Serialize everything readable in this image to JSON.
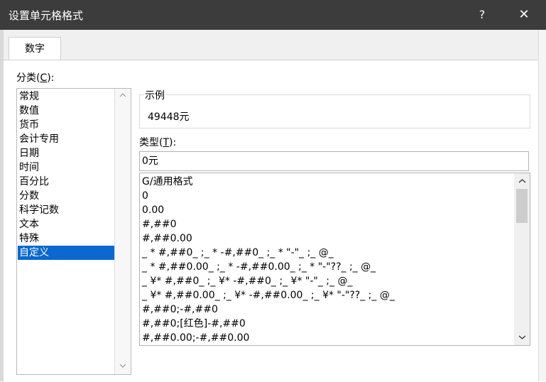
{
  "dialog": {
    "title": "设置单元格格式",
    "help_label": "?",
    "close_label": "✕"
  },
  "tabs": [
    {
      "label": "数字"
    }
  ],
  "category": {
    "label_prefix": "分类(",
    "label_key": "C",
    "label_suffix": "):",
    "items": [
      "常规",
      "数值",
      "货币",
      "会计专用",
      "日期",
      "时间",
      "百分比",
      "分数",
      "科学记数",
      "文本",
      "特殊",
      "自定义"
    ],
    "selected": "自定义"
  },
  "sample": {
    "label": "示例",
    "value": "49448元"
  },
  "type": {
    "label_prefix": "类型(",
    "label_key": "T",
    "label_suffix": "):",
    "value": "0元"
  },
  "formats": [
    "G/通用格式",
    "0",
    "0.00",
    "#,##0",
    "#,##0.00",
    "_ * #,##0_ ;_ * -#,##0_ ;_ * \"-\"_ ;_ @_",
    "_ * #,##0.00_ ;_ * -#,##0.00_ ;_ * \"-\"??_ ;_ @_",
    "_ ¥* #,##0_ ;_ ¥* -#,##0_ ;_ ¥* \"-\"_ ;_ @_",
    "_ ¥* #,##0.00_ ;_ ¥* -#,##0.00_ ;_ ¥* \"-\"??_ ;_ @_",
    "#,##0;-#,##0",
    "#,##0;[红色]-#,##0",
    "#,##0.00;-#,##0.00"
  ],
  "icons": {
    "scroll_up": "chevron-up-icon",
    "scroll_down": "chevron-down-icon"
  },
  "colors": {
    "titlebar": "#3c3c3c",
    "selection": "#0a68d0"
  }
}
